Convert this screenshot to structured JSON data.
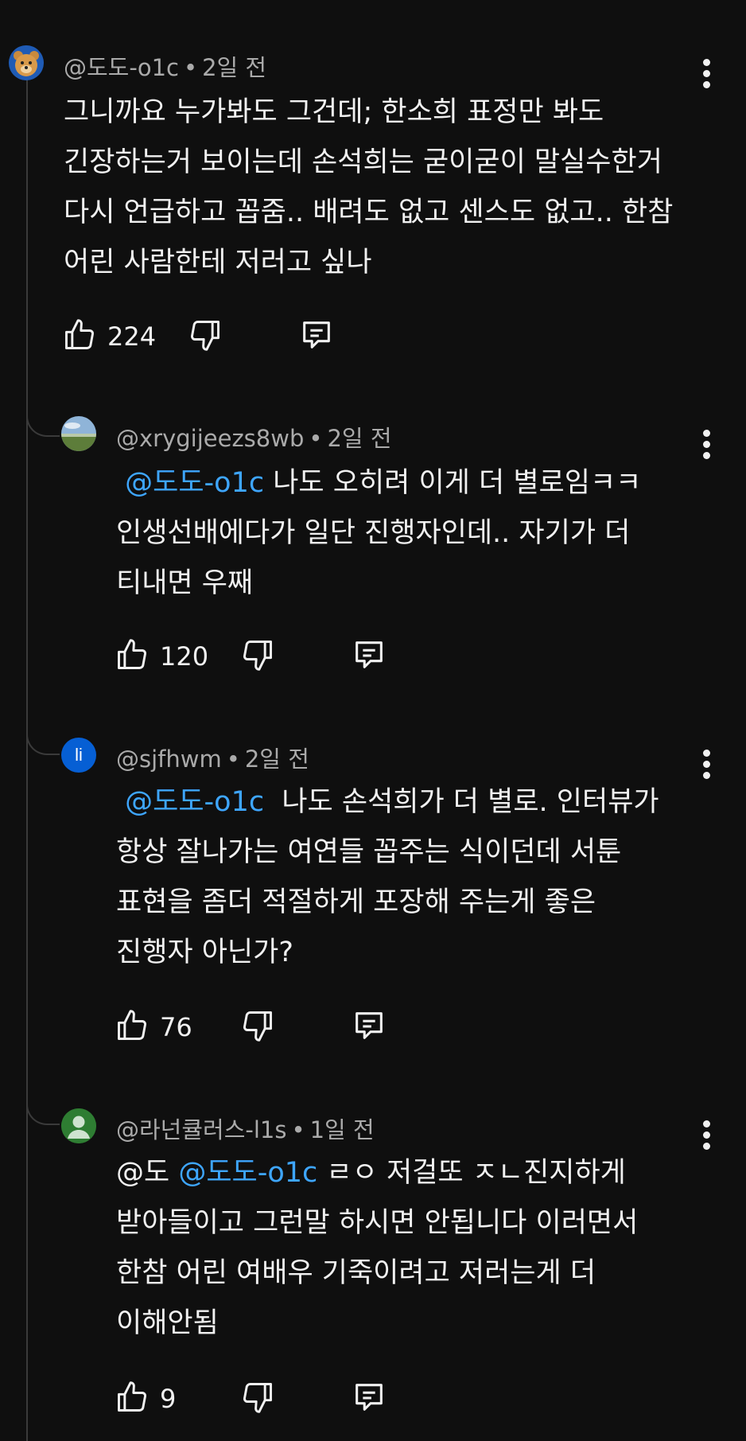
{
  "comments": [
    {
      "handle": "@도도-o1c",
      "time": "2일 전",
      "lines": [
        {
          "text": "그니까요 누가봐도 그건데; 한소희 표정만 봐도"
        },
        {
          "text": "긴장하는거 보이는데 손석희는 굳이굳이 말실수한거"
        },
        {
          "text": "다시 언급하고 꼽줌.. 배려도 없고 센스도 없고.. 한참"
        },
        {
          "text": "어린 사람한테 저러고 싶나"
        }
      ],
      "likes": "224"
    },
    {
      "handle": "@xrygijeezs8wb",
      "time": "2일 전",
      "lines": [
        {
          "mention": "@도도-o1c",
          "text": " 나도 오히려 이게 더 별로임ㅋㅋ"
        },
        {
          "text": "인생선배에다가 일단 진행자인데.. 자기가 더"
        },
        {
          "text": "티내면 우째"
        }
      ],
      "likes": "120"
    },
    {
      "handle": "@sjfhwm",
      "time": "2일 전",
      "avatar_letter": "li",
      "lines": [
        {
          "mention": "@도도-o1c",
          "text": "  나도 손석희가 더 별로. 인터뷰가"
        },
        {
          "text": "항상 잘나가는 여연들 꼽주는 식이던데 서툰"
        },
        {
          "text": "표현을 좀더 적절하게 포장해 주는게 좋은"
        },
        {
          "text": "진행자 아닌가?"
        }
      ],
      "likes": "76"
    },
    {
      "handle": "@라넌큘러스-l1s",
      "time": "1일 전",
      "lines": [
        {
          "prefix": "@도 ",
          "mention": "@도도-o1c",
          "text": " ㄹㅇ 저걸또 ㅈㄴ진지하게"
        },
        {
          "text": "받아들이고 그런말 하시면 안됩니다 이러면서"
        },
        {
          "text": "한참 어린 여배우 기죽이려고 저러는게 더"
        },
        {
          "text": "이해안됨"
        }
      ],
      "likes": "9"
    }
  ],
  "icons": {
    "like": "thumb-up-icon",
    "dislike": "thumb-down-icon",
    "reply": "reply-icon",
    "more": "more-vert-icon"
  },
  "colors": {
    "background": "#0f0f0f",
    "text": "#f1f1f1",
    "meta": "#aaaaaa",
    "mention": "#3ea6ff",
    "avatar_blue": "#065fd4",
    "avatar_green": "#2e7d32"
  }
}
